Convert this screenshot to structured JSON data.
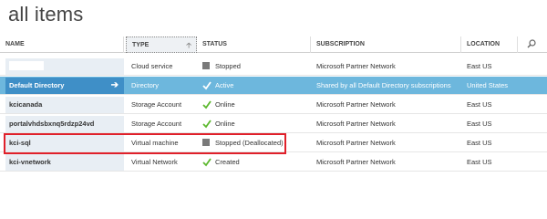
{
  "page": {
    "title": "all items"
  },
  "columns": {
    "name": "NAME",
    "type": "TYPE",
    "status": "STATUS",
    "subscription": "SUBSCRIPTION",
    "location": "LOCATION"
  },
  "rows": [
    {
      "name": "",
      "type": "Cloud service",
      "status": "Stopped",
      "status_icon": "stopped-square",
      "subscription": "Microsoft Partner Network",
      "location": "East US"
    },
    {
      "name": "Default Directory",
      "type": "Directory",
      "status": "Active",
      "status_icon": "check",
      "subscription": "Shared by all Default Directory subscriptions",
      "location": "United States"
    },
    {
      "name": "kcicanada",
      "type": "Storage Account",
      "status": "Online",
      "status_icon": "check",
      "subscription": "Microsoft Partner Network",
      "location": "East US"
    },
    {
      "name": "portalvhdsbxnq5rdzp24vd",
      "type": "Storage Account",
      "status": "Online",
      "status_icon": "check",
      "subscription": "Microsoft Partner Network",
      "location": "East US"
    },
    {
      "name": "kci-sql",
      "type": "Virtual machine",
      "status": "Stopped (Deallocated)",
      "status_icon": "stopped-square",
      "subscription": "Microsoft Partner Network",
      "location": "East US"
    },
    {
      "name": "kci-vnetwork",
      "type": "Virtual Network",
      "status": "Created",
      "status_icon": "check",
      "subscription": "Microsoft Partner Network",
      "location": "East US"
    }
  ],
  "colors": {
    "selected_row": "#6db7dd",
    "selected_name": "#3f8fc7",
    "check_green": "#5cb82e",
    "highlight_red": "#e0202a"
  }
}
